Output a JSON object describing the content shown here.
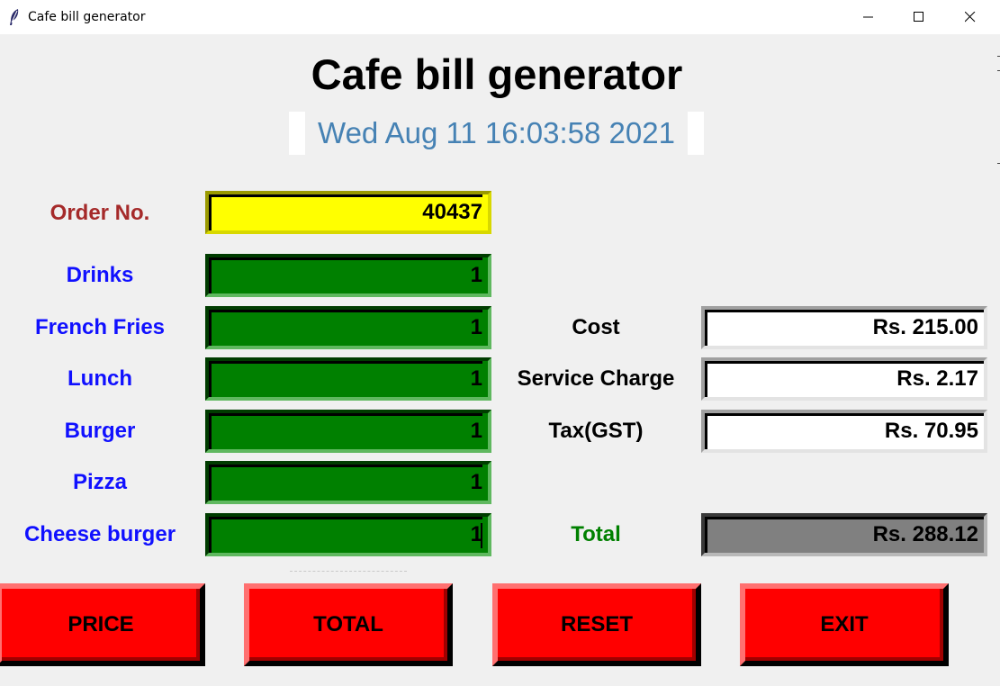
{
  "window": {
    "title": "Cafe bill generator",
    "controls": [
      "minimize",
      "maximize",
      "close"
    ]
  },
  "header": {
    "title": "Cafe bill generator",
    "datetime": "Wed Aug 11 16:03:58 2021"
  },
  "order": {
    "label": "Order No.",
    "value": "40437"
  },
  "items": [
    {
      "label": "Drinks",
      "qty": "1"
    },
    {
      "label": "French Fries",
      "qty": "1"
    },
    {
      "label": "Lunch",
      "qty": "1"
    },
    {
      "label": "Burger",
      "qty": "1"
    },
    {
      "label": "Pizza",
      "qty": "1"
    },
    {
      "label": "Cheese burger",
      "qty": "1"
    }
  ],
  "summary": {
    "cost_label": "Cost",
    "cost_value": "Rs. 215.00",
    "service_label": "Service Charge",
    "service_value": "Rs. 2.17",
    "tax_label": "Tax(GST)",
    "tax_value": "Rs. 70.95",
    "total_label": "Total",
    "total_value": "Rs. 288.12"
  },
  "buttons": {
    "price": "PRICE",
    "total": "TOTAL",
    "reset": "RESET",
    "exit": "EXIT"
  },
  "colors": {
    "order_field": "#ffff00",
    "qty_field": "#008000",
    "total_field": "#808080",
    "buttons": "#ff0000",
    "item_labels": "#1010ff",
    "order_label": "#a52a2a",
    "total_label": "#008000",
    "date_text": "#4682b4"
  },
  "icons": {
    "app": "feather-icon"
  }
}
